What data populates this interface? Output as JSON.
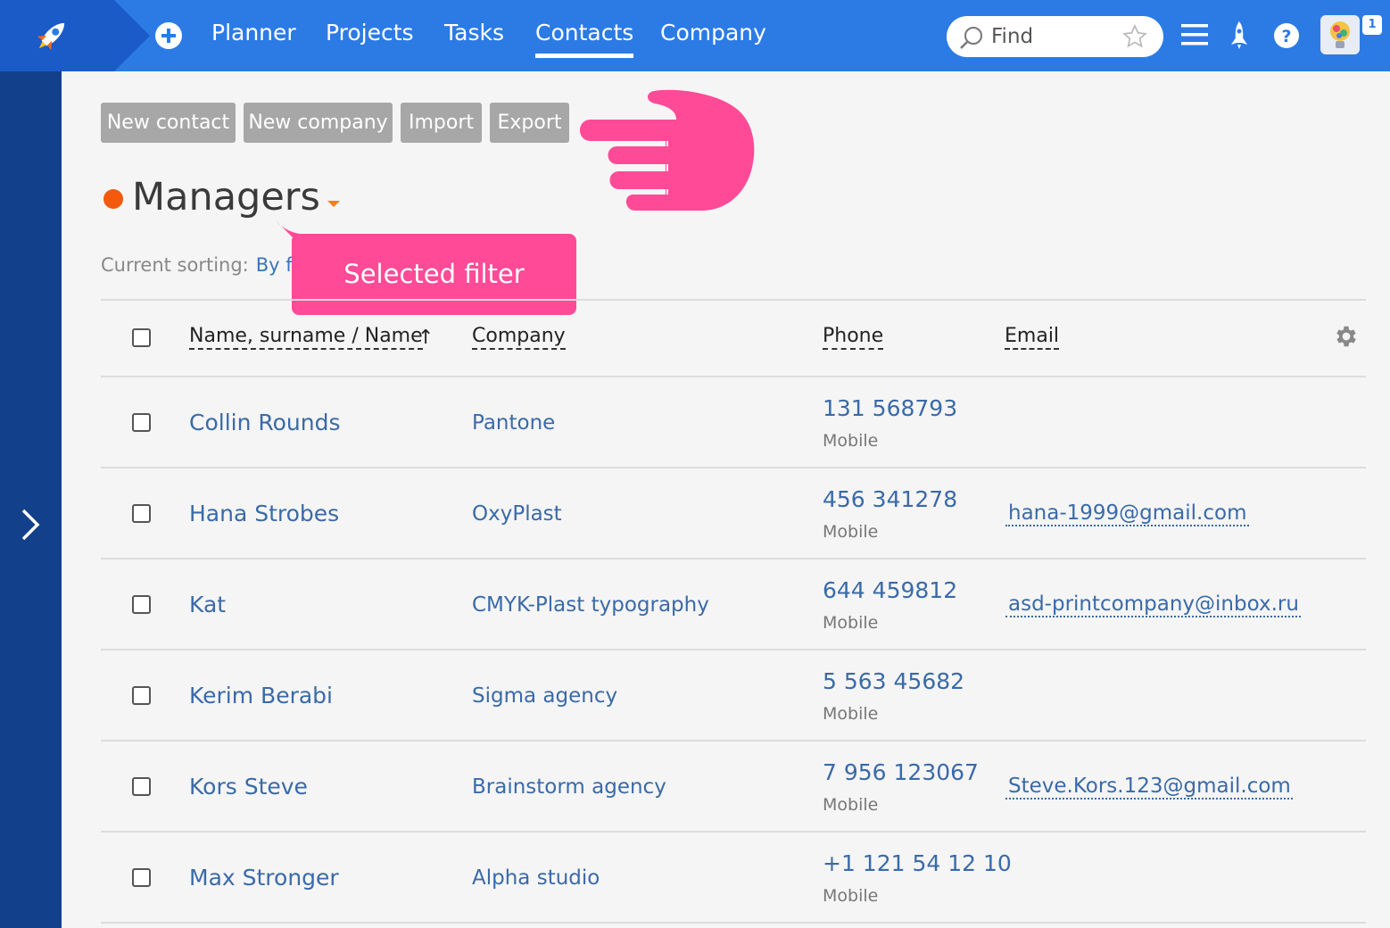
{
  "topbar": {
    "nav": [
      "Planner",
      "Projects",
      "Tasks",
      "Contacts",
      "Company"
    ],
    "active_nav": "Contacts",
    "search_placeholder": "Find",
    "notification_count": "1",
    "colors": {
      "bar": "#2c7be5",
      "logo_bg": "#1a5bc8"
    }
  },
  "toolbar": {
    "new_contact": "New contact",
    "new_company": "New company",
    "import": "Import",
    "export": "Export"
  },
  "filter": {
    "title": "Managers",
    "dot_color": "#f35a0d"
  },
  "sorting": {
    "label": "Current sorting:",
    "value": "By f"
  },
  "callout": {
    "text": "Selected filter",
    "color": "#ff4a97"
  },
  "table": {
    "columns": [
      "Name, surname / Name",
      "Company",
      "Phone",
      "Email"
    ],
    "sort_indicator": "↑",
    "rows": [
      {
        "name": "Collin Rounds",
        "company": "Pantone",
        "phone": "131 568793",
        "phone_type": "Mobile",
        "email": ""
      },
      {
        "name": "Hana Strobes",
        "company": "OxyPlast",
        "phone": "456 341278",
        "phone_type": "Mobile",
        "email": "hana-1999@gmail.com"
      },
      {
        "name": "Kat",
        "company": "CMYK-Plast typography",
        "phone": "644 459812",
        "phone_type": "Mobile",
        "email": "asd-printcompany@inbox.ru"
      },
      {
        "name": "Kerim Berabi",
        "company": "Sigma agency",
        "phone": "5 563 45682",
        "phone_type": "Mobile",
        "email": ""
      },
      {
        "name": "Kors Steve",
        "company": "Brainstorm agency",
        "phone": "7 956 123067",
        "phone_type": "Mobile",
        "email": "Steve.Kors.123@gmail.com"
      },
      {
        "name": "Max Stronger",
        "company": "Alpha studio",
        "phone": "+1 121 54 12 10",
        "phone_type": "Mobile",
        "email": ""
      }
    ]
  }
}
